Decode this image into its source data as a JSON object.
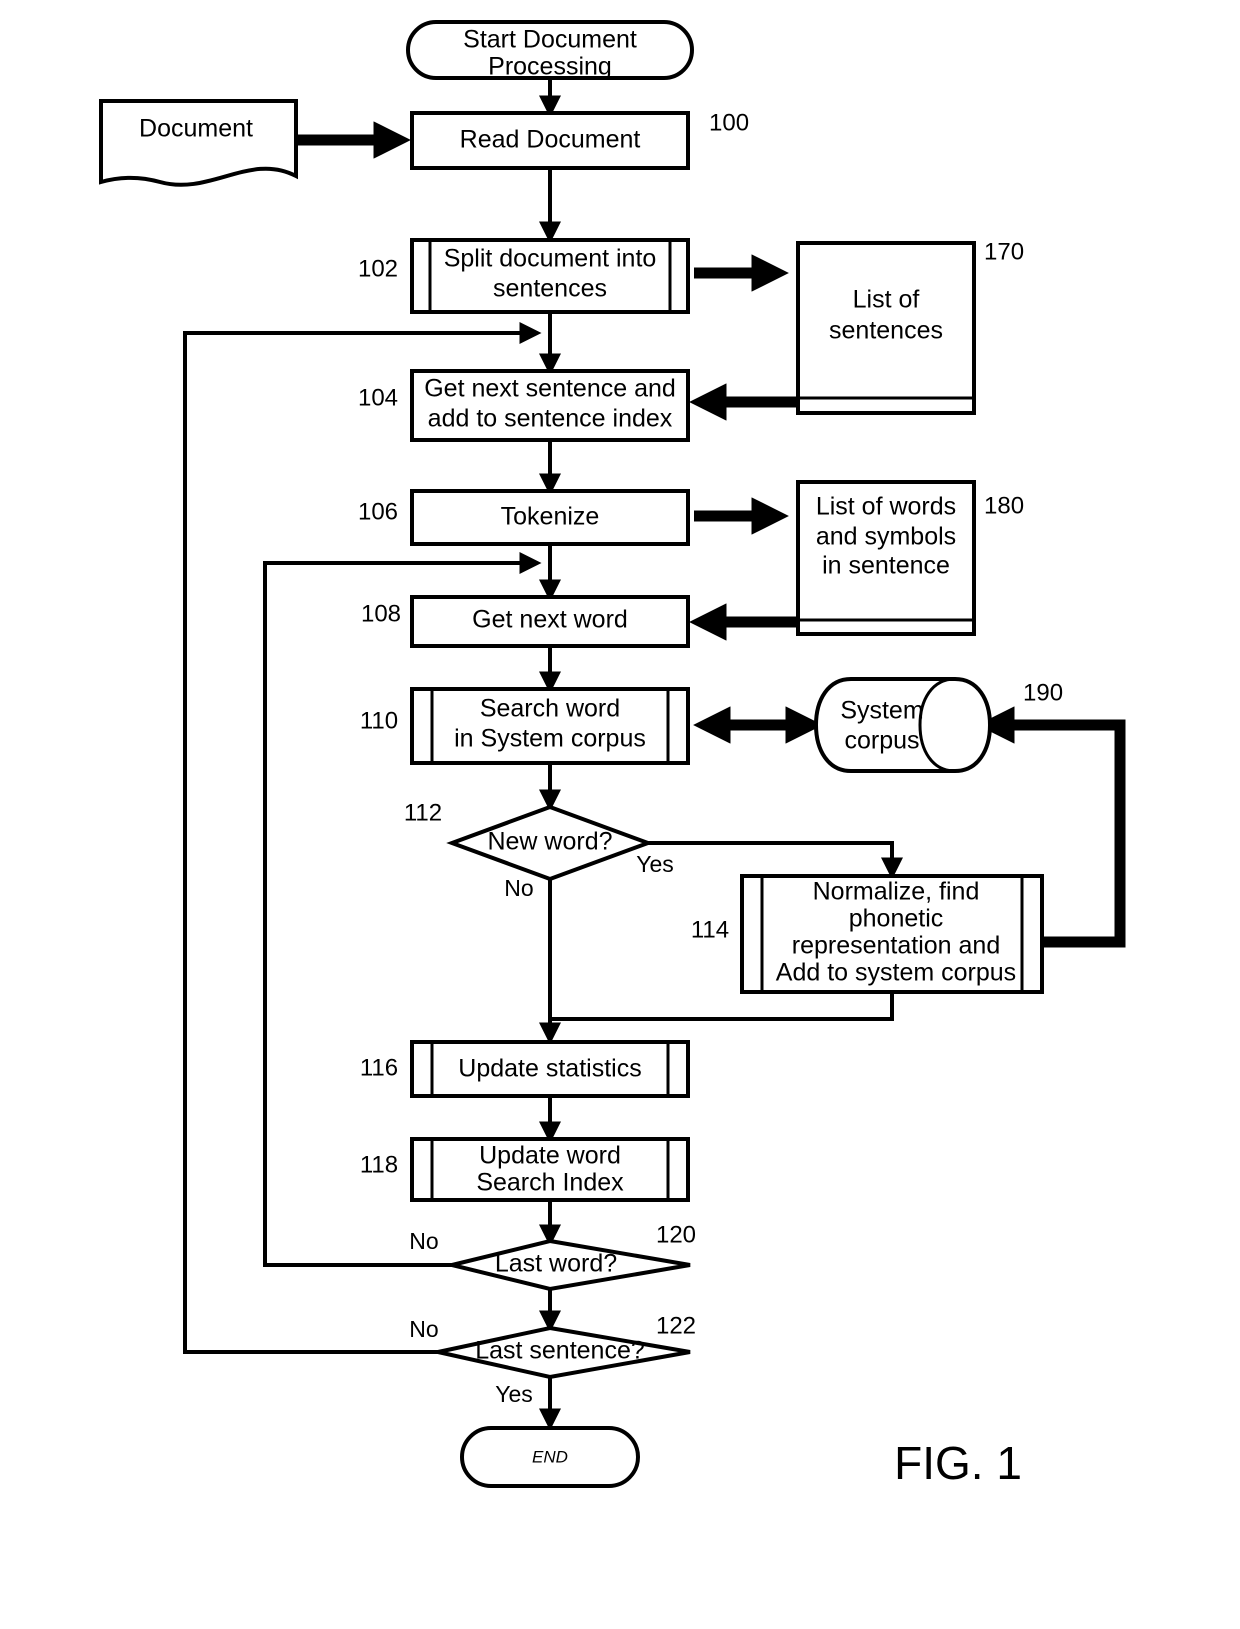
{
  "figure": {
    "label": "FIG. 1"
  },
  "nodes": {
    "start": {
      "label_line1": "Start Document",
      "label_line2": "Processing",
      "ref": ""
    },
    "document_input": {
      "label": "Document",
      "ref": ""
    },
    "read_document": {
      "label": "Read Document",
      "ref": "100"
    },
    "split_document": {
      "label_line1": "Split document into",
      "label_line2": "sentences",
      "ref": "102"
    },
    "list_of_sentences": {
      "label_line1": "List of",
      "label_line2": "sentences",
      "ref": "170"
    },
    "get_next_sentence": {
      "label_line1": "Get next sentence and",
      "label_line2": "add to sentence index",
      "ref": "104"
    },
    "tokenize": {
      "label": "Tokenize",
      "ref": "106"
    },
    "list_of_words": {
      "label_line1": "List of words",
      "label_line2": "and symbols",
      "label_line3": "in sentence",
      "ref": "180"
    },
    "get_next_word": {
      "label": "Get next word",
      "ref": "108"
    },
    "search_word": {
      "label_line1": "Search word",
      "label_line2": "in System corpus",
      "ref": "110"
    },
    "system_corpus": {
      "label_line1": "System",
      "label_line2": "corpus",
      "ref": "190"
    },
    "new_word_decision": {
      "label": "New word?",
      "ref": "112"
    },
    "normalize": {
      "label_line1": "Normalize, find",
      "label_line2": "phonetic",
      "label_line3": "representation and",
      "label_line4": "Add to system corpus",
      "ref": "114"
    },
    "update_statistics": {
      "label": "Update statistics",
      "ref": "116"
    },
    "update_search_index": {
      "label_line1": "Update word",
      "label_line2": "Search Index",
      "ref": "118"
    },
    "last_word_decision": {
      "label": "Last word?",
      "ref": "120"
    },
    "last_sentence_decision": {
      "label": "Last sentence?",
      "ref": "122"
    },
    "end": {
      "label": "END",
      "ref": ""
    }
  },
  "edge_labels": {
    "new_word_yes": "Yes",
    "new_word_no": "No",
    "last_word_no": "No",
    "last_sentence_no": "No",
    "last_sentence_yes": "Yes"
  },
  "colors": {
    "stroke": "#000000",
    "fill": "#ffffff",
    "background": "#ffffff"
  }
}
